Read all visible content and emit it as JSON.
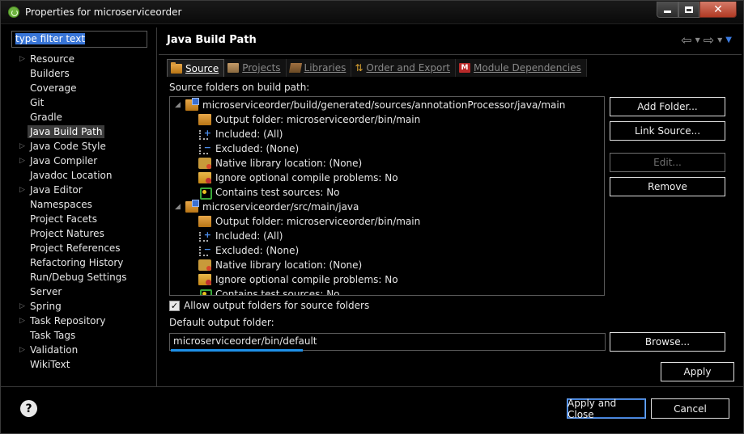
{
  "window": {
    "title": "Properties for microserviceorder"
  },
  "nav": {
    "filter_text": "type filter text",
    "items": [
      {
        "label": "Resource",
        "expandable": true
      },
      {
        "label": "Builders",
        "expandable": false
      },
      {
        "label": "Coverage",
        "expandable": false
      },
      {
        "label": "Git",
        "expandable": false
      },
      {
        "label": "Gradle",
        "expandable": false
      },
      {
        "label": "Java Build Path",
        "expandable": false,
        "selected": true
      },
      {
        "label": "Java Code Style",
        "expandable": true
      },
      {
        "label": "Java Compiler",
        "expandable": true
      },
      {
        "label": "Javadoc Location",
        "expandable": false
      },
      {
        "label": "Java Editor",
        "expandable": true
      },
      {
        "label": "Namespaces",
        "expandable": false
      },
      {
        "label": "Project Facets",
        "expandable": false
      },
      {
        "label": "Project Natures",
        "expandable": false
      },
      {
        "label": "Project References",
        "expandable": false
      },
      {
        "label": "Refactoring History",
        "expandable": false
      },
      {
        "label": "Run/Debug Settings",
        "expandable": false
      },
      {
        "label": "Server",
        "expandable": false
      },
      {
        "label": "Spring",
        "expandable": true
      },
      {
        "label": "Task Repository",
        "expandable": true
      },
      {
        "label": "Task Tags",
        "expandable": false
      },
      {
        "label": "Validation",
        "expandable": true
      },
      {
        "label": "WikiText",
        "expandable": false
      }
    ]
  },
  "page": {
    "title": "Java Build Path",
    "tabs": [
      {
        "label": "Source",
        "icon": "source-folder-icon",
        "active": true
      },
      {
        "label": "Projects",
        "icon": "projects-icon",
        "active": false
      },
      {
        "label": "Libraries",
        "icon": "libraries-icon",
        "active": false
      },
      {
        "label": "Order and Export",
        "icon": "order-export-icon",
        "active": false
      },
      {
        "label": "Module Dependencies",
        "icon": "module-icon",
        "active": false
      }
    ],
    "source_label": "Source folders on build path:",
    "source_folders": [
      {
        "path": "microserviceorder/build/generated/sources/annotationProcessor/java/main",
        "children": [
          {
            "icon": "output-folder-icon",
            "text": "Output folder: microserviceorder/bin/main"
          },
          {
            "icon": "included-icon",
            "text": "Included: (All)"
          },
          {
            "icon": "excluded-icon",
            "text": "Excluded: (None)"
          },
          {
            "icon": "native-library-icon",
            "text": "Native library location: (None)"
          },
          {
            "icon": "ignore-problems-icon",
            "text": "Ignore optional compile problems: No"
          },
          {
            "icon": "test-sources-icon",
            "text": "Contains test sources: No"
          }
        ]
      },
      {
        "path": "microserviceorder/src/main/java",
        "children": [
          {
            "icon": "output-folder-icon",
            "text": "Output folder: microserviceorder/bin/main"
          },
          {
            "icon": "included-icon",
            "text": "Included: (All)"
          },
          {
            "icon": "excluded-icon",
            "text": "Excluded: (None)"
          },
          {
            "icon": "native-library-icon",
            "text": "Native library location: (None)"
          },
          {
            "icon": "ignore-problems-icon",
            "text": "Ignore optional compile problems: No"
          },
          {
            "icon": "test-sources-icon",
            "text": "Contains test sources: No"
          }
        ]
      }
    ],
    "side_buttons": {
      "add_folder": "Add Folder...",
      "link_source": "Link Source...",
      "edit": "Edit...",
      "remove": "Remove"
    },
    "allow_output_checkbox": {
      "label": "Allow output folders for source folders",
      "checked": true
    },
    "default_output_label": "Default output folder:",
    "default_output_value": "microserviceorder/bin/default",
    "browse_button": "Browse...",
    "apply_button": "Apply"
  },
  "footer": {
    "apply_close": "Apply and Close",
    "cancel": "Cancel"
  }
}
